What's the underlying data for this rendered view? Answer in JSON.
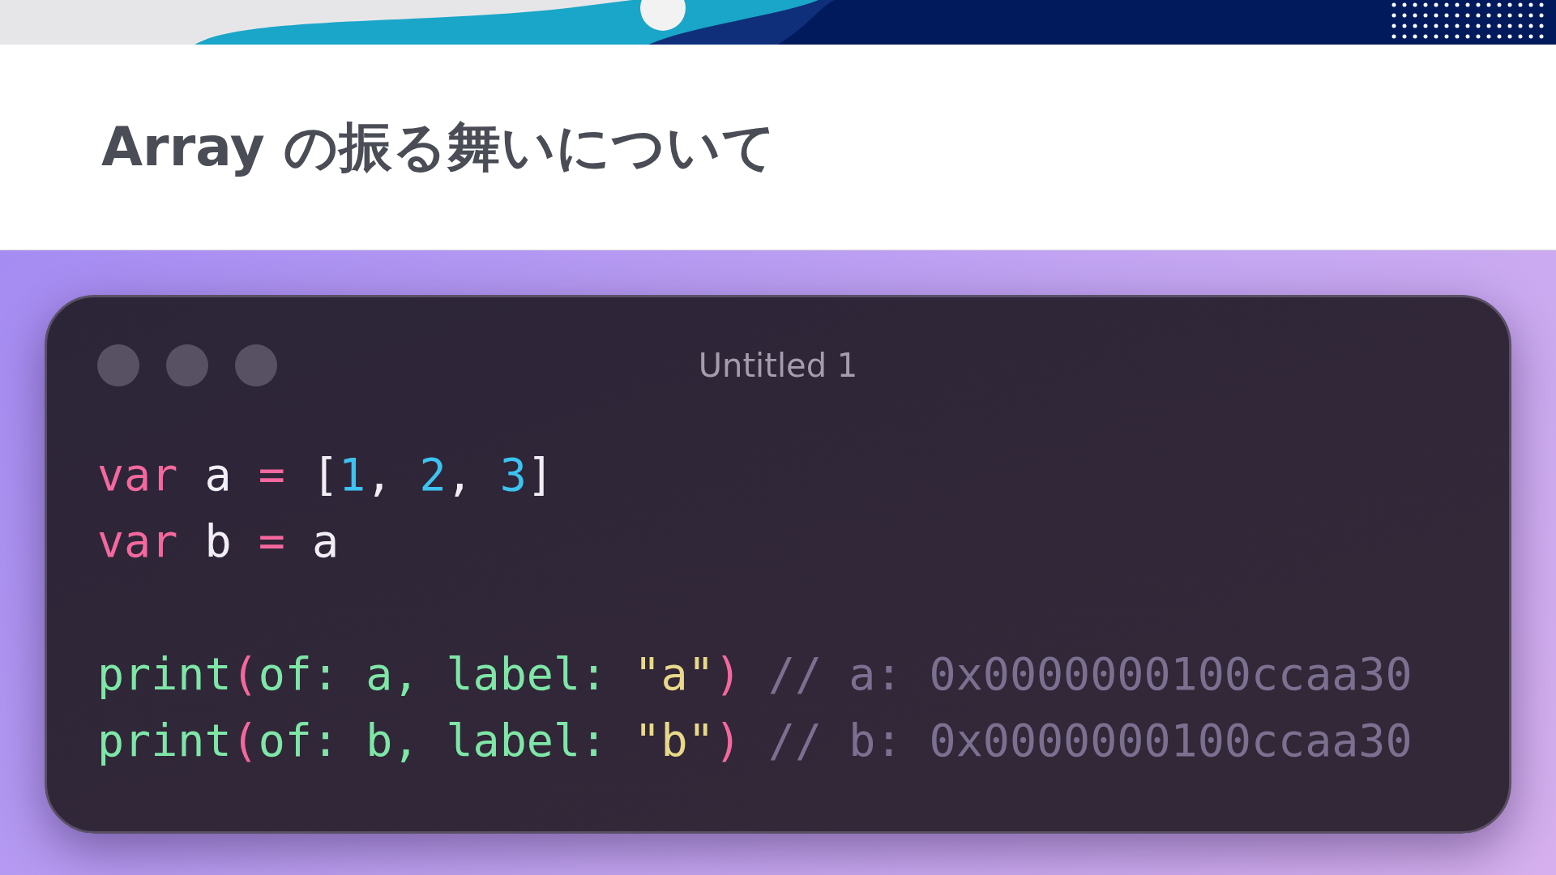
{
  "slide": {
    "title": "Array の振る舞いについて"
  },
  "editor": {
    "title": "Untitled 1",
    "blocks": [
      [
        [
          {
            "text": "var",
            "kind": "keyword"
          },
          {
            "text": " a ",
            "kind": "ident"
          },
          {
            "text": "=",
            "kind": "op"
          },
          {
            "text": " [",
            "kind": "ident"
          },
          {
            "text": "1",
            "kind": "number"
          },
          {
            "text": ", ",
            "kind": "ident"
          },
          {
            "text": "2",
            "kind": "number"
          },
          {
            "text": ", ",
            "kind": "ident"
          },
          {
            "text": "3",
            "kind": "number"
          },
          {
            "text": "]",
            "kind": "ident"
          }
        ],
        [
          {
            "text": "var",
            "kind": "keyword"
          },
          {
            "text": " b ",
            "kind": "ident"
          },
          {
            "text": "=",
            "kind": "op"
          },
          {
            "text": " a",
            "kind": "ident"
          }
        ]
      ],
      [
        [
          {
            "text": "print",
            "kind": "func"
          },
          {
            "text": "(",
            "kind": "op"
          },
          {
            "text": "of:",
            "kind": "func"
          },
          {
            "text": " a, ",
            "kind": "param"
          },
          {
            "text": "label:",
            "kind": "func"
          },
          {
            "text": " \"a\"",
            "kind": "string"
          },
          {
            "text": ")",
            "kind": "op"
          },
          {
            "text": " // a: 0x0000000100ccaa30",
            "kind": "comment"
          }
        ],
        [
          {
            "text": "print",
            "kind": "func"
          },
          {
            "text": "(",
            "kind": "op"
          },
          {
            "text": "of:",
            "kind": "func"
          },
          {
            "text": " b, ",
            "kind": "param"
          },
          {
            "text": "label:",
            "kind": "func"
          },
          {
            "text": " \"b\"",
            "kind": "string"
          },
          {
            "text": ")",
            "kind": "op"
          },
          {
            "text": " // b: 0x0000000100ccaa30",
            "kind": "comment"
          }
        ]
      ]
    ]
  }
}
